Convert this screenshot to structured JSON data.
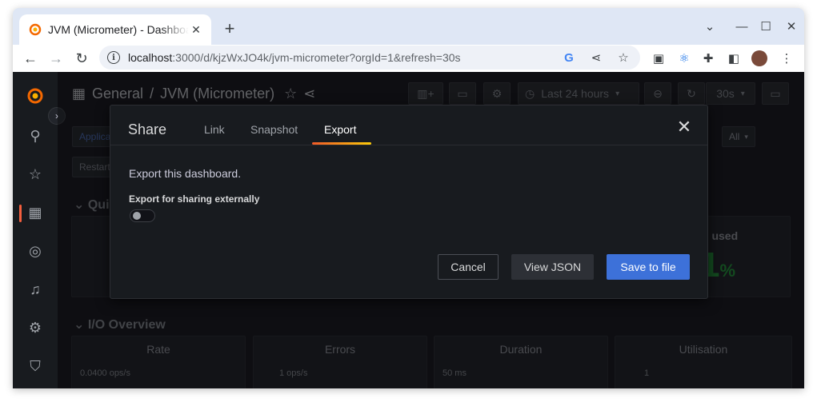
{
  "browser": {
    "tab_title": "JVM (Micrometer) - Dashboard",
    "url_host": "localhost",
    "url_rest": ":3000/d/kjzWxJO4k/jvm-micrometer?orgId=1&refresh=30s"
  },
  "dashboard": {
    "folder": "General",
    "separator": "/",
    "title": "JVM (Micrometer)",
    "time_range": "Last 24 hours",
    "refresh": "30s",
    "var_application": "Applica",
    "var_all": "All",
    "var_restart": "Restart",
    "row_quick": "Quic",
    "row_io": "I/O Overview",
    "bg_panel_title_fragment": "p used",
    "bg_big_number": "1",
    "bg_big_unit": "%",
    "io_panels": [
      {
        "title": "Rate",
        "axis": "0.0400 ops/s"
      },
      {
        "title": "Errors",
        "axis": "1 ops/s"
      },
      {
        "title": "Duration",
        "axis": "50 ms"
      },
      {
        "title": "Utilisation",
        "axis": "1"
      }
    ]
  },
  "share_modal": {
    "title": "Share",
    "tabs": [
      "Link",
      "Snapshot",
      "Export"
    ],
    "active_tab": "Export",
    "description": "Export this dashboard.",
    "switch_label": "Export for sharing externally",
    "switch_on": false,
    "cancel_label": "Cancel",
    "view_json_label": "View JSON",
    "save_label": "Save to file"
  },
  "colors": {
    "primary_button": "#3d71d9",
    "tab_underline": "#f05a28",
    "big_number": "#1a7f2e"
  }
}
